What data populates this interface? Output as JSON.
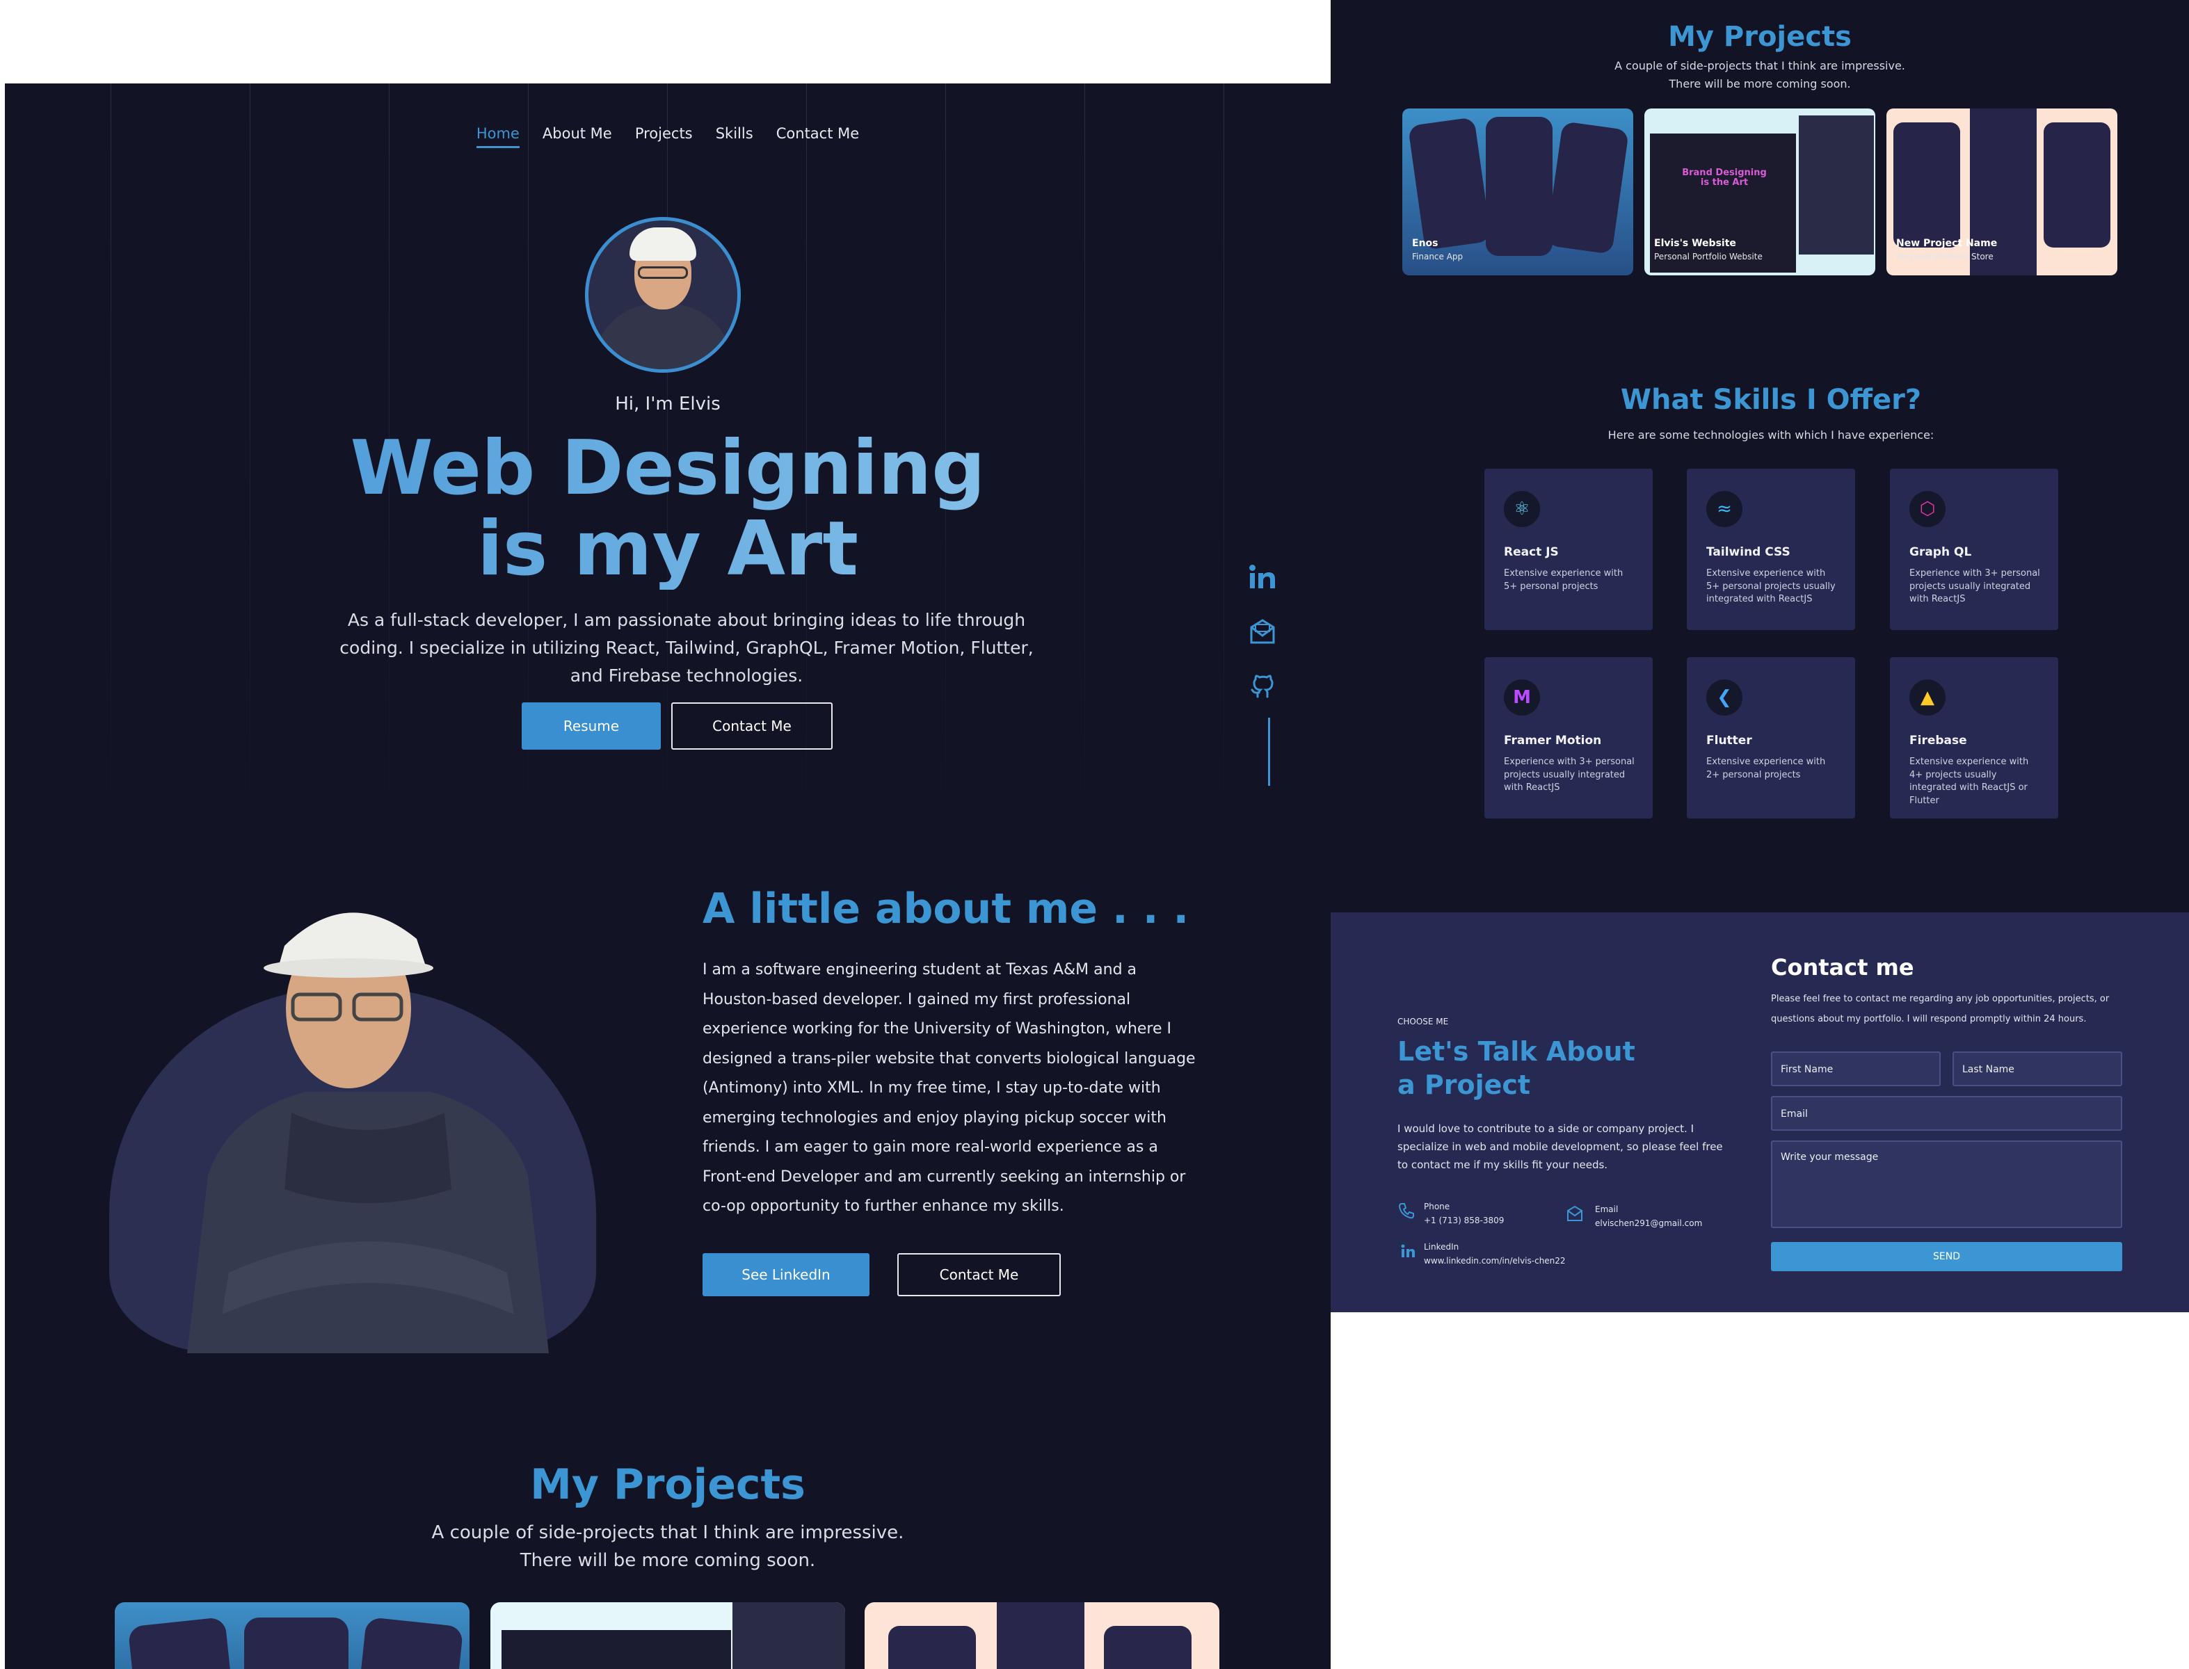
{
  "left": {
    "nav": [
      "Home",
      "About Me",
      "Projects",
      "Skills",
      "Contact Me"
    ],
    "hero": {
      "greeting": "Hi, I'm Elvis",
      "title_line1": "Web Designing",
      "title_line2": "is my Art",
      "description": "As a full-stack developer, I am passionate about bringing ideas to life through coding. I specialize in utilizing React, Tailwind, GraphQL, Framer Motion, Flutter, and Firebase technologies.",
      "resume_button": "Resume",
      "contact_button": "Contact Me"
    },
    "social": [
      "linkedin-icon",
      "mail-icon",
      "github-icon"
    ],
    "about": {
      "title": "A little about me . . .",
      "text": "I am a software engineering student at Texas A&M and a Houston-based developer. I gained my first professional experience working for the University of Washington, where I designed a trans-piler website that converts biological language (Antimony) into XML.  In my free time, I stay up-to-date with emerging technologies and enjoy playing pickup soccer with friends. I am eager to gain more real-world experience as a Front-end Developer and am currently seeking an internship or co-op opportunity to further enhance my skills.",
      "linkedin_button": "See LinkedIn",
      "contact_button": "Contact Me"
    },
    "projects": {
      "title": "My Projects",
      "sub1": "A couple of side-projects that I think are impressive.",
      "sub2": "There will be more coming soon."
    }
  },
  "right": {
    "projects": {
      "title": "My Projects",
      "sub1": "A couple of side-projects that I think are impressive.",
      "sub2": "There will be more coming soon.",
      "cards": [
        {
          "title": "Enos",
          "subtitle": "Finance App"
        },
        {
          "title": "Elvis's Website",
          "subtitle": "Personal Portfolio Website",
          "mock_title": "Brand Designing is the Art"
        },
        {
          "title": "New Project Name",
          "subtitle": "Personal Portfolio Store"
        }
      ]
    },
    "skills": {
      "title": "What Skills I Offer?",
      "subtitle": "Here are some technologies with which I have experience:",
      "items": [
        {
          "name": "React JS",
          "desc": "Extensive experience with 5+ personal projects",
          "icon": "react-icon",
          "color": "#61dafb"
        },
        {
          "name": "Tailwind CSS",
          "desc": "Extensive experience with 5+ personal projects usually integrated with ReactJS",
          "icon": "tailwind-icon",
          "color": "#38bdf8"
        },
        {
          "name": "Graph QL",
          "desc": "Experience with 3+ personal projects usually integrated with ReactJS",
          "icon": "graphql-icon",
          "color": "#e535ab"
        },
        {
          "name": "Framer Motion",
          "desc": "Experience with 3+ personal projects usually integrated with ReactJS",
          "icon": "framer-motion-icon",
          "color": "#bb4bff"
        },
        {
          "name": "Flutter",
          "desc": "Extensive experience with 2+ personal projects",
          "icon": "flutter-icon",
          "color": "#42a5f5"
        },
        {
          "name": "Firebase",
          "desc": "Extensive experience with 4+ projects usually integrated with ReactJS or Flutter",
          "icon": "firebase-icon",
          "color": "#ffca28"
        }
      ]
    },
    "contact": {
      "kicker": "CHOOSE ME",
      "heading1": "Let's Talk About",
      "heading2": "a Project",
      "text": "I would love to contribute to a side or company project. I specialize in web and mobile development, so please feel free to contact me if my skills fit your needs.",
      "phone_label": "Phone",
      "phone": "+1 (713) 858-3809",
      "email_label": "Email",
      "email": "elvischen291@gmail.com",
      "linkedin_label": "LinkedIn",
      "linkedin": "www.linkedin.com/in/elvis-chen22",
      "form_title": "Contact me",
      "form_text": "Please feel free to contact me regarding any job opportunities, projects, or questions about my portfolio. I will respond promptly within 24 hours.",
      "first_name": "First Name",
      "last_name": "Last Name",
      "email_field": "Email",
      "message": "Write your message",
      "send": "SEND"
    }
  },
  "colors": {
    "accent": "#3b96d3",
    "background": "#121425",
    "card": "#262a52"
  }
}
